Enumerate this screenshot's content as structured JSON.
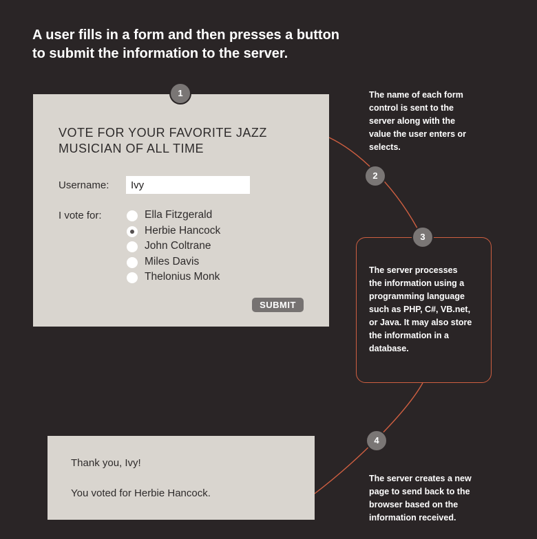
{
  "heading": [
    "A user fills in a form and then presses a button",
    "to submit the information to the server."
  ],
  "form": {
    "title_lines": [
      "VOTE FOR YOUR FAVORITE JAZZ",
      "MUSICIAN OF ALL TIME"
    ],
    "username_label": "Username:",
    "username_value": "Ivy",
    "vote_label": "I vote for:",
    "options": [
      {
        "label": "Ella Fitzgerald",
        "selected": false
      },
      {
        "label": "Herbie Hancock",
        "selected": true
      },
      {
        "label": "John Coltrane",
        "selected": false
      },
      {
        "label": "Miles Davis",
        "selected": false
      },
      {
        "label": "Thelonius Monk",
        "selected": false
      }
    ],
    "submit_label": "SUBMIT"
  },
  "result": {
    "thanks": "Thank you, Ivy!",
    "voted": "You voted for Herbie Hancock."
  },
  "steps": [
    "1",
    "2",
    "3",
    "4"
  ],
  "notes": {
    "step2": [
      "The name of each form",
      "control is sent to the",
      "server along with the",
      "value the user enters or",
      "selects."
    ],
    "step3": [
      "The server processes",
      "the information using a",
      "programming language",
      "such as PHP, C#, VB.net,",
      "or Java. It may also store",
      "the information in a",
      "database."
    ],
    "step4": [
      "The server creates a new",
      "page to send back to the",
      "browser based on the",
      "information received."
    ]
  },
  "colors": {
    "background": "#2a2526",
    "panel": "#d9d5cf",
    "accent_line": "#cf5f41",
    "step_badge": "#7a7675"
  }
}
